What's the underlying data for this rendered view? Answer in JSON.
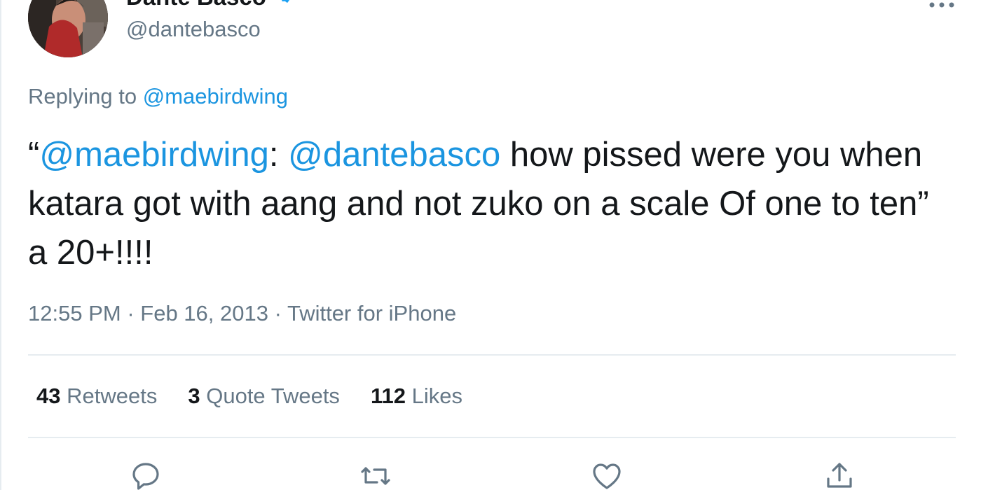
{
  "author": {
    "name": "Dante Basco",
    "handle": "@dantebasco",
    "verified": true
  },
  "more_icon": "more-horizontal-icon",
  "replying": {
    "prefix": "Replying to ",
    "handle": "@maebirdwing"
  },
  "tweet": {
    "open_quote": "“",
    "mention1": "@maebirdwing",
    "colon": ": ",
    "mention2": "@dantebasco",
    "body": " how pissed were you when katara got with aang and not zuko on a scale Of one to ten” a 20+!!!!"
  },
  "meta": {
    "time": "12:55 PM",
    "sep1": " · ",
    "date": "Feb 16, 2013",
    "sep2": " · ",
    "source": "Twitter for iPhone"
  },
  "stats": {
    "retweets_count": "43",
    "retweets_label": "Retweets",
    "quotes_count": "3",
    "quotes_label": "Quote Tweets",
    "likes_count": "112",
    "likes_label": "Likes"
  },
  "actions": [
    "reply-icon",
    "retweet-icon",
    "like-icon",
    "share-icon"
  ],
  "colors": {
    "link": "#1b95e0",
    "text": "#14171a",
    "secondary": "#657786",
    "divider": "#e6ecf0"
  }
}
